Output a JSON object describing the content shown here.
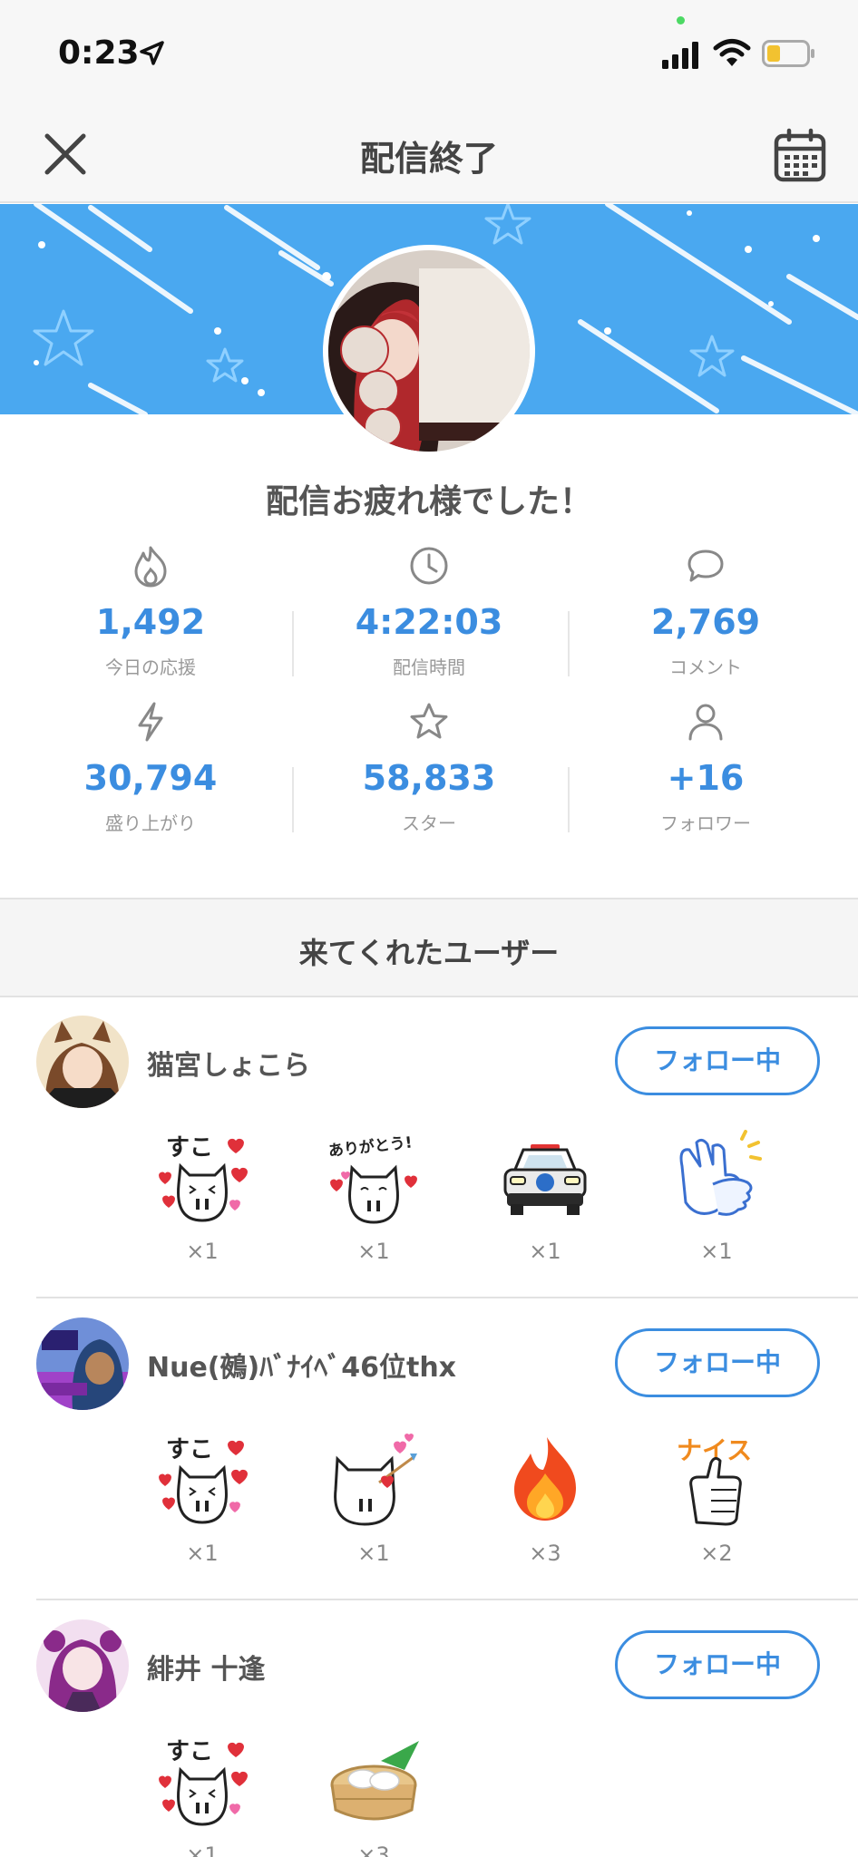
{
  "status_bar": {
    "time": "0:23"
  },
  "nav": {
    "title": "配信終了"
  },
  "thanks_message": "配信お疲れ様でした！",
  "stats": [
    {
      "icon": "flame-icon",
      "value": "1,492",
      "label": "今日の応援"
    },
    {
      "icon": "clock-icon",
      "value": "4:22:03",
      "label": "配信時間"
    },
    {
      "icon": "comment-icon",
      "value": "2,769",
      "label": "コメント"
    },
    {
      "icon": "lightning-icon",
      "value": "30,794",
      "label": "盛り上がり"
    },
    {
      "icon": "star-icon",
      "value": "58,833",
      "label": "スター"
    },
    {
      "icon": "person-icon",
      "value": "+16",
      "label": "フォロワー"
    }
  ],
  "section_title": "来てくれたユーザー",
  "users": [
    {
      "name": "猫宮しょこら",
      "follow_label": "フォロー中",
      "gifts": [
        {
          "icon": "suko-cat-sticker",
          "count": "×1"
        },
        {
          "icon": "arigatou-cat-sticker",
          "count": "×1"
        },
        {
          "icon": "police-car-sticker",
          "count": "×1"
        },
        {
          "icon": "clapping-hands-sticker",
          "count": "×1"
        }
      ]
    },
    {
      "name": "Nue(鵺)ﾊﾞﾅｲﾍﾞ46位thx",
      "follow_label": "フォロー中",
      "gifts": [
        {
          "icon": "suko-cat-sticker",
          "count": "×1"
        },
        {
          "icon": "cupid-cat-sticker",
          "count": "×1"
        },
        {
          "icon": "fire-sticker",
          "count": "×3"
        },
        {
          "icon": "nice-thumbs-up-sticker",
          "count": "×2"
        }
      ]
    },
    {
      "name": "緋井 十逢",
      "follow_label": "フォロー中",
      "gifts": [
        {
          "icon": "suko-cat-sticker",
          "count": "×1"
        },
        {
          "icon": "dumpling-steamer-sticker",
          "count": "×3"
        }
      ]
    }
  ]
}
